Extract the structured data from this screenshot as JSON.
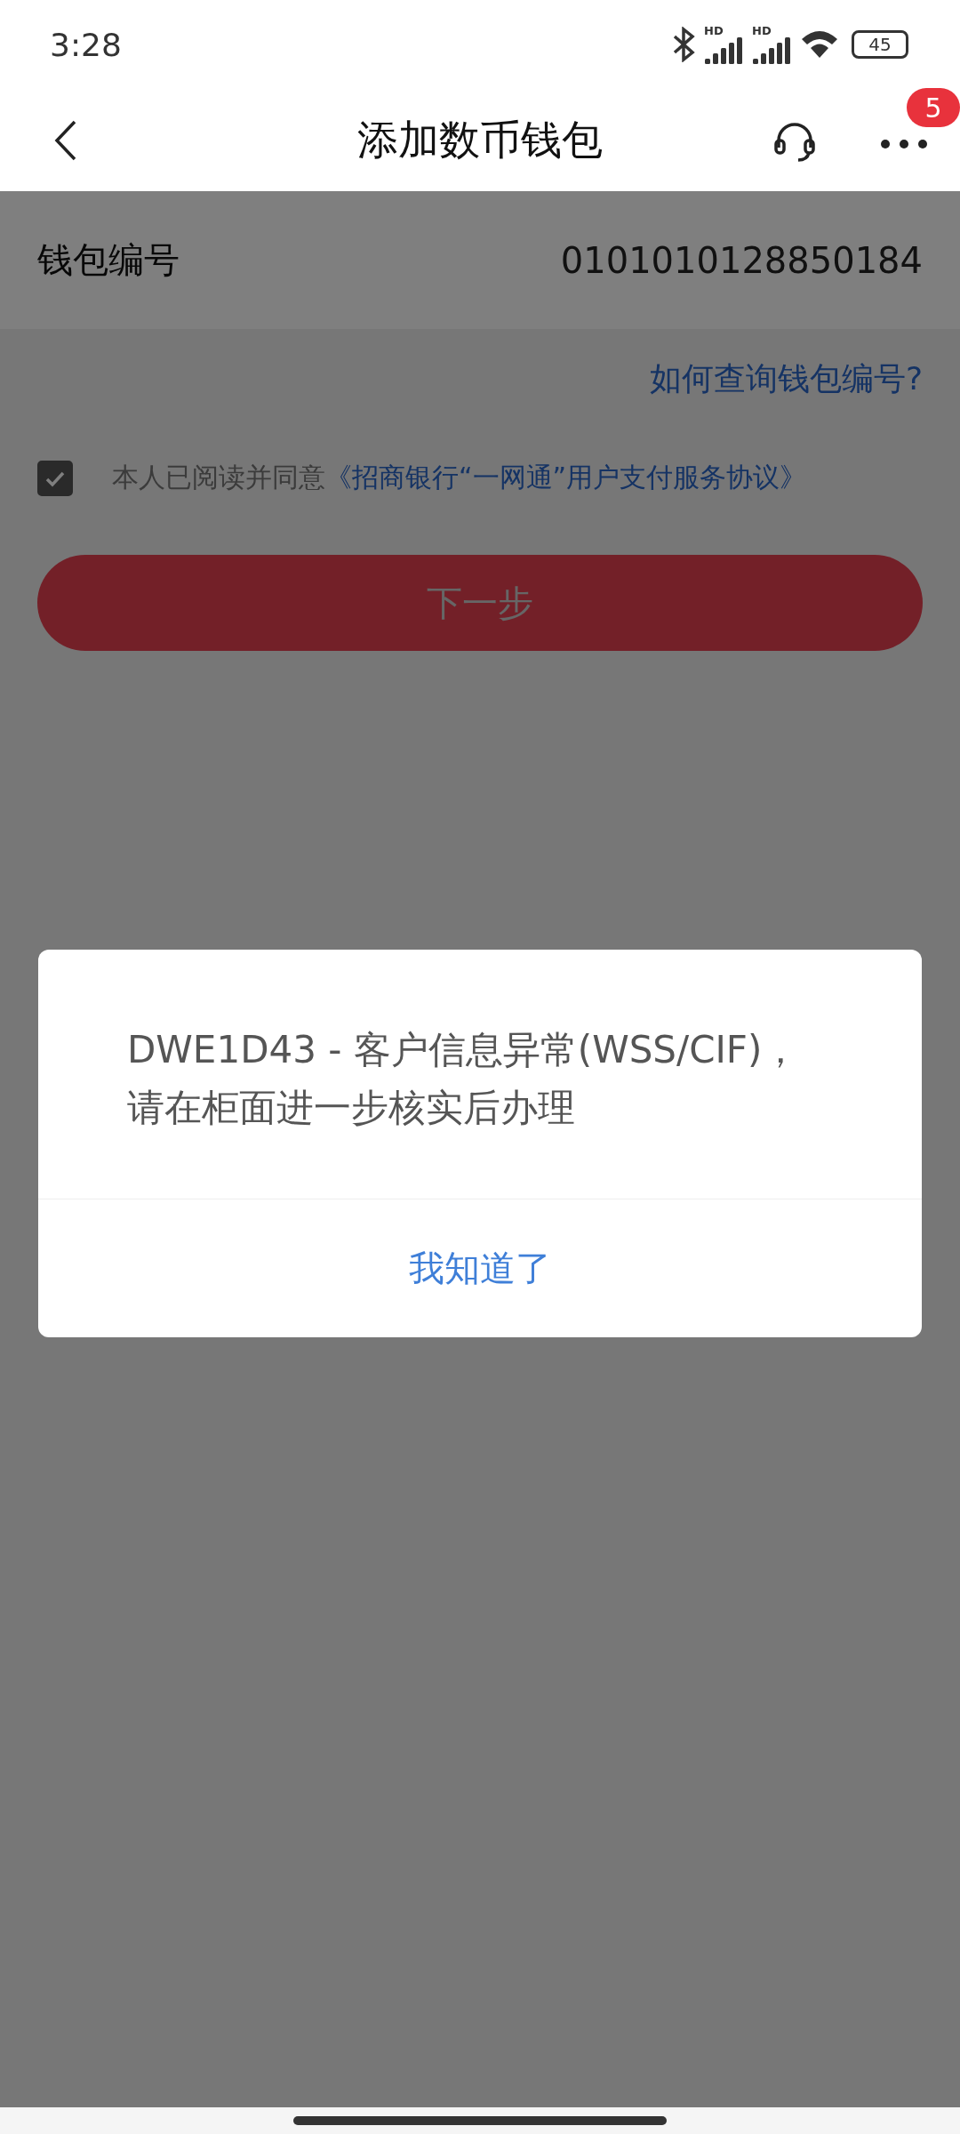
{
  "status_bar": {
    "time": "3:28",
    "signals": [
      {
        "label": "HD"
      },
      {
        "label": "HD"
      }
    ],
    "battery": "45"
  },
  "header": {
    "title": "添加数币钱包",
    "badge": "5"
  },
  "wallet": {
    "label": "钱包编号",
    "value": "0101010128850184"
  },
  "help_link": "如何查询钱包编号?",
  "agreement": {
    "checked": true,
    "text": "本人已阅读并同意",
    "link": "《招商银行“一网通”用户支付服务协议》"
  },
  "next_button": "下一步",
  "dialog": {
    "message": "DWE1D43 - 客户信息异常(WSS/CIF)，请在柜面进一步核实后办理",
    "button": "我知道了"
  }
}
